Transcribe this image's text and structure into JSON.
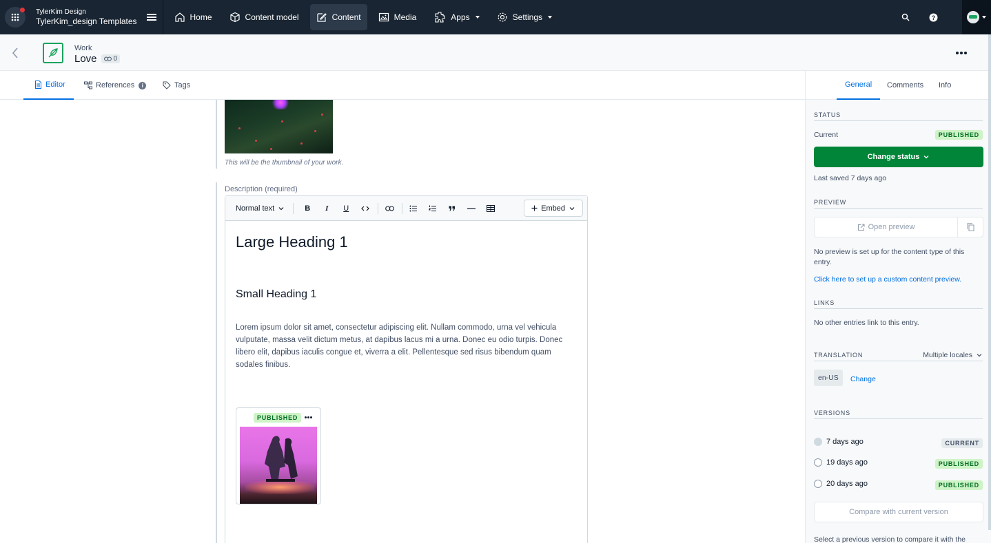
{
  "topnav": {
    "org": "TylerKim Design",
    "space": "TylerKim_design Templates",
    "items": [
      {
        "label": "Home",
        "icon": "home-icon"
      },
      {
        "label": "Content model",
        "icon": "content-model-icon"
      },
      {
        "label": "Content",
        "icon": "content-icon"
      },
      {
        "label": "Media",
        "icon": "media-icon"
      },
      {
        "label": "Apps",
        "icon": "apps-icon"
      },
      {
        "label": "Settings",
        "icon": "gear-icon"
      }
    ]
  },
  "entry": {
    "content_type": "Work",
    "title": "Love",
    "reference_count": "0"
  },
  "tabs": {
    "editor": "Editor",
    "references": "References",
    "tags": "Tags",
    "references_info": "i"
  },
  "editor": {
    "thumbnail_help": "This will be the thumbnail of your work.",
    "description_label": "Description (required)",
    "toolbar": {
      "text_style": "Normal text",
      "bold": "B",
      "italic": "I",
      "underline": "U",
      "embed": "Embed"
    },
    "heading_large": "Large Heading 1",
    "heading_small": "Small Heading 1",
    "paragraph": "Lorem ipsum dolor sit amet, consectetur adipiscing elit. Nullam commodo, urna vel vehicula vulputate, massa velit dictum metus, at dapibus lacus mi a urna. Donec eu odio turpis. Donec libero elit, dapibus iaculis congue et, viverra a elit. Pellentesque sed risus bibendum quam sodales finibus.",
    "embedded_asset_status": "PUBLISHED"
  },
  "sidebar": {
    "tabs": [
      "General",
      "Comments",
      "Info"
    ],
    "status": {
      "title": "STATUS",
      "current_label": "Current",
      "current_value": "PUBLISHED",
      "change_button": "Change status",
      "last_saved": "Last saved 7 days ago"
    },
    "preview": {
      "title": "PREVIEW",
      "button": "Open preview",
      "note": "No preview is set up for the content type of this entry.",
      "link": "Click here to set up a custom content preview."
    },
    "links": {
      "title": "LINKS",
      "note": "No other entries link to this entry."
    },
    "translation": {
      "title": "TRANSLATION",
      "mode": "Multiple locales",
      "locale": "en-US",
      "change": "Change"
    },
    "versions": {
      "title": "VERSIONS",
      "items": [
        {
          "date": "7 days ago",
          "status": "CURRENT"
        },
        {
          "date": "19 days ago",
          "status": "PUBLISHED"
        },
        {
          "date": "20 days ago",
          "status": "PUBLISHED"
        }
      ],
      "compare_button": "Compare with current version",
      "hint": "Select a previous version to compare it with the"
    }
  },
  "colors": {
    "nav_bg": "#192532",
    "accent": "#036fe3",
    "success": "#008539",
    "published_badge_bg": "#cdf3c6"
  }
}
